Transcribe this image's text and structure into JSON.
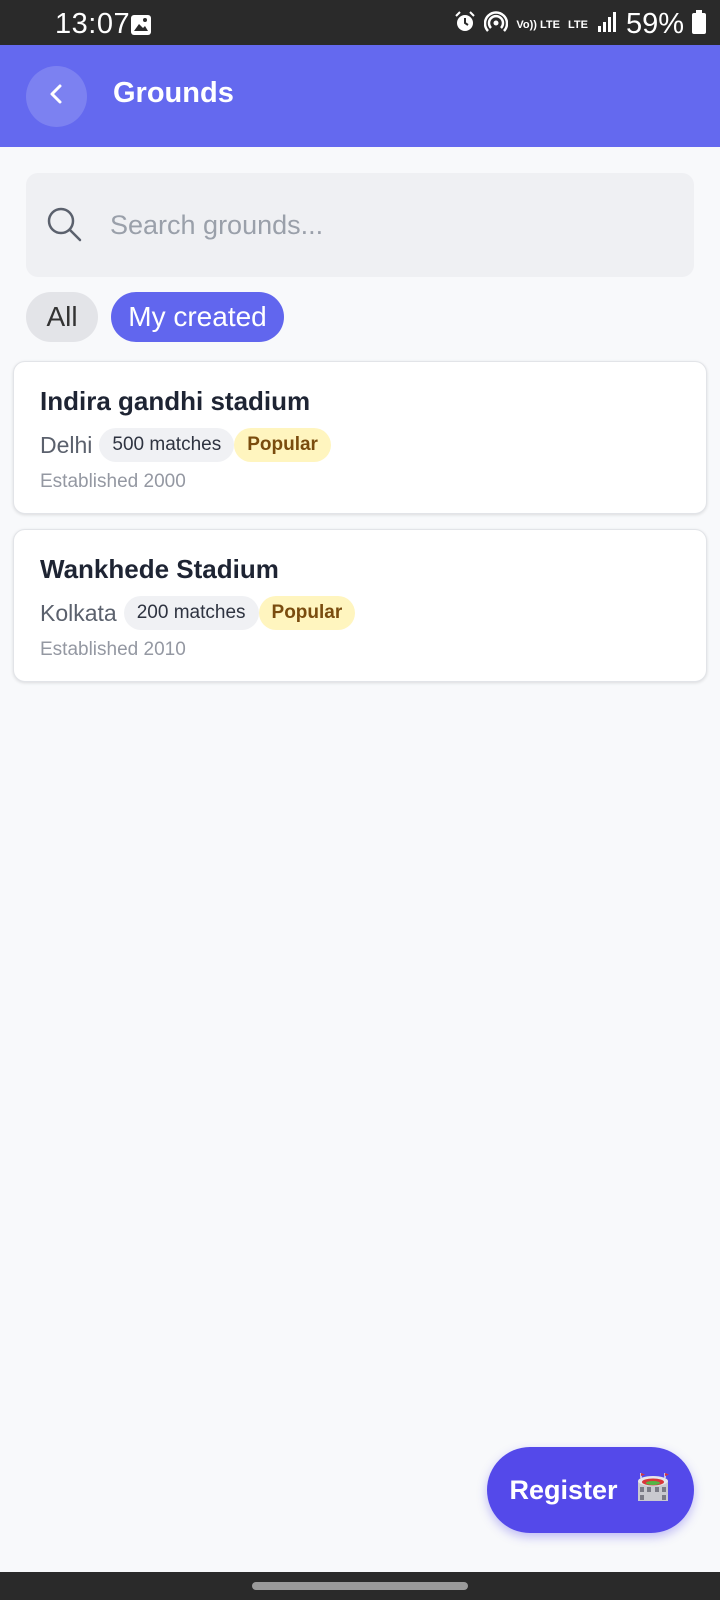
{
  "status_bar": {
    "time": "13:07",
    "battery": "59%",
    "volte_label": "Vo)) LTE",
    "lte_label": "LTE",
    "icons": [
      "gallery-icon",
      "alarm-icon",
      "hotspot-icon",
      "volte-icon",
      "lte-icon",
      "signal-icon",
      "battery-icon"
    ]
  },
  "header": {
    "title": "Grounds",
    "back_icon": "chevron-left-icon",
    "color": "#6469ef"
  },
  "search": {
    "placeholder": "Search grounds...",
    "value": "",
    "icon": "search-icon"
  },
  "filters": [
    {
      "label": "All",
      "selected": false
    },
    {
      "label": "My created",
      "selected": true
    }
  ],
  "grounds": [
    {
      "name": "Indira gandhi stadium",
      "city": "Delhi",
      "matches": "500 matches",
      "badge": "Popular",
      "established": "Established 2000"
    },
    {
      "name": "Wankhede Stadium",
      "city": "Kolkata",
      "matches": "200 matches",
      "badge": "Popular",
      "established": "Established 2010"
    }
  ],
  "fab": {
    "label": "Register",
    "icon": "stadium-icon",
    "color": "#5449ea"
  },
  "accent_color": "#6166ee"
}
